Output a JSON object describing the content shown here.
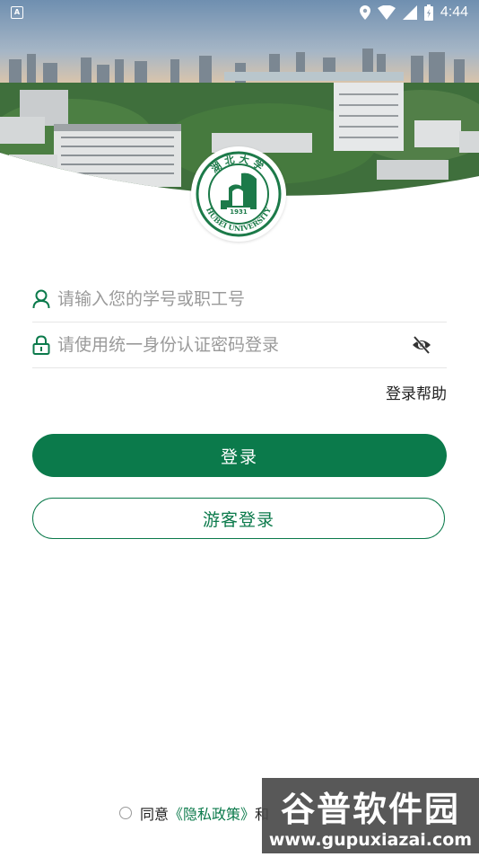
{
  "status_bar": {
    "time": "4:44",
    "icons": [
      "notification-icon",
      "location-icon",
      "wifi-icon",
      "signal-icon",
      "battery-icon"
    ]
  },
  "logo": {
    "name": "Hubei University emblem",
    "text_top": "湖北大学",
    "text_bottom": "HUBEI UNIVERSITY",
    "year": "1931"
  },
  "form": {
    "username_placeholder": "请输入您的学号或职工号",
    "password_placeholder": "请使用统一身份认证密码登录",
    "help_label": "登录帮助"
  },
  "buttons": {
    "login_label": "登录",
    "guest_label": "游客登录"
  },
  "agreement": {
    "prefix": "同意",
    "privacy_link": "《隐私政策》",
    "joiner": "和"
  },
  "watermark": {
    "title": "谷普软件园",
    "url": "www.gupuxiazai.com"
  },
  "colors": {
    "accent": "#0b7a4b",
    "placeholder": "#9a9a9a",
    "divider": "#e6e6e6"
  }
}
